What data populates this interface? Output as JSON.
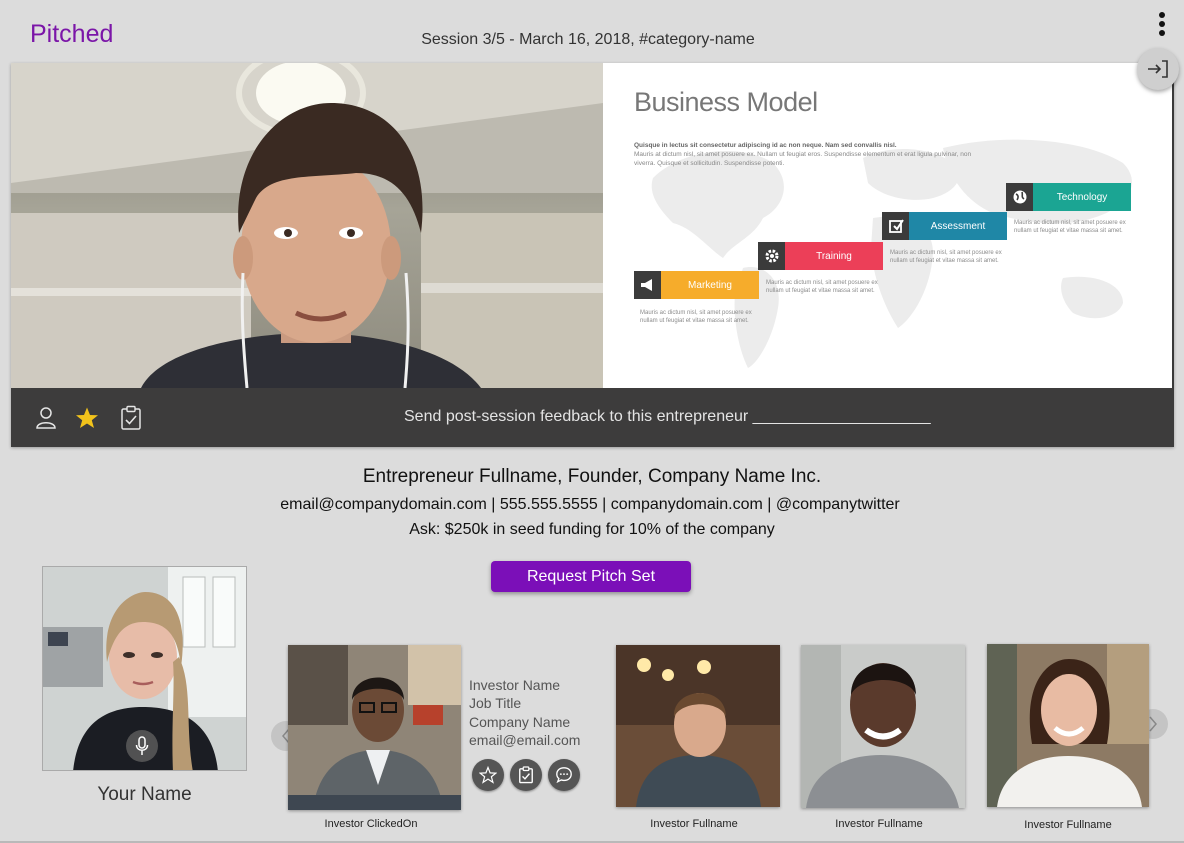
{
  "app": {
    "brand": "Pitched",
    "session_title": "Session 3/5 - March 16, 2018, #category-name"
  },
  "toolbar": {
    "feedback_text": "Send post-session feedback to this entrepreneur ____________________"
  },
  "slide": {
    "title": "Business Model",
    "lead_bold": "Quisque in lectus sit consectetur adipiscing id ac non neque. Nam sed convallis nisl.",
    "lead_body": "Mauris at dictum nisl, sit amet posuere ex. Nullam ut feugiat eros. Suspendisse elementum et erat ligula pulvinar, non viverra. Quisque et sollicitudin. Suspendisse potenti.",
    "steps": [
      {
        "label": "Marketing",
        "color": "#f6ac2b",
        "icon": "megaphone-icon",
        "note": "Mauris ac dictum nisl, sit amet posuere ex nullam ut feugiat et vitae massa sit amet."
      },
      {
        "label": "Training",
        "color": "#ec3f58",
        "icon": "gear-icon",
        "note": "Mauris ac dictum nisl, sit amet posuere ex nullam ut feugiat et vitae massa sit amet."
      },
      {
        "label": "Assessment",
        "color": "#1f87a6",
        "icon": "checkbox-icon",
        "note": "Mauris ac dictum nisl, sit amet posuere ex nullam ut feugiat et vitae massa sit amet."
      },
      {
        "label": "Technology",
        "color": "#1ba593",
        "icon": "globe-icon",
        "note": "Mauris ac dictum nisl, sit amet posuere ex nullam ut feugiat et vitae massa sit amet."
      }
    ]
  },
  "entrepreneur": {
    "headline": "Entrepreneur Fullname, Founder, Company Name Inc.",
    "contact": "email@companydomain.com | 555.555.5555 | companydomain.com | @companytwitter",
    "ask": "Ask: $250k in seed funding for 10% of the company"
  },
  "actions": {
    "request_pitch_set": "Request Pitch Set"
  },
  "self": {
    "name": "Your Name"
  },
  "investors": {
    "selected": {
      "caption": "Investor ClickedOn",
      "name": "Investor Name",
      "job_title": "Job Title",
      "company": "Company Name",
      "email": "email@email.com"
    },
    "others": [
      {
        "caption": "Investor Fullname"
      },
      {
        "caption": "Investor Fullname"
      },
      {
        "caption": "Investor Fullname"
      }
    ]
  },
  "colors": {
    "brand": "#7b16a8",
    "button": "#7b0fb8",
    "toolbar": "#3d3c3c",
    "star": "#f2c31b"
  }
}
